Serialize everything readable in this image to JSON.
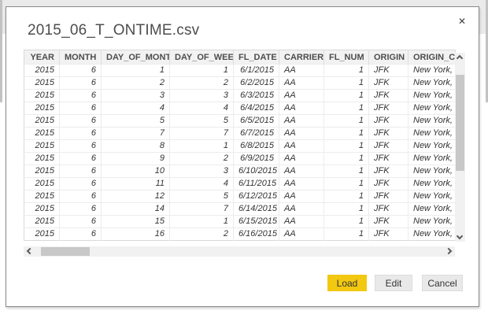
{
  "dialog": {
    "title": "2015_06_T_ONTIME.csv",
    "close_glyph": "✕"
  },
  "table": {
    "columns": [
      {
        "label": "YEAR",
        "align": "right"
      },
      {
        "label": "MONTH",
        "align": "right"
      },
      {
        "label": "DAY_OF_MONTH",
        "align": "right"
      },
      {
        "label": "DAY_OF_WEEK",
        "align": "right"
      },
      {
        "label": "FL_DATE",
        "align": "right"
      },
      {
        "label": "CARRIER",
        "align": "left"
      },
      {
        "label": "FL_NUM",
        "align": "right"
      },
      {
        "label": "ORIGIN",
        "align": "left"
      },
      {
        "label": "ORIGIN_CI",
        "align": "left"
      }
    ],
    "rows": [
      [
        "2015",
        "6",
        "1",
        "1",
        "6/1/2015",
        "AA",
        "1",
        "JFK",
        "New York,"
      ],
      [
        "2015",
        "6",
        "2",
        "2",
        "6/2/2015",
        "AA",
        "1",
        "JFK",
        "New York,"
      ],
      [
        "2015",
        "6",
        "3",
        "3",
        "6/3/2015",
        "AA",
        "1",
        "JFK",
        "New York,"
      ],
      [
        "2015",
        "6",
        "4",
        "4",
        "6/4/2015",
        "AA",
        "1",
        "JFK",
        "New York,"
      ],
      [
        "2015",
        "6",
        "5",
        "5",
        "6/5/2015",
        "AA",
        "1",
        "JFK",
        "New York,"
      ],
      [
        "2015",
        "6",
        "7",
        "7",
        "6/7/2015",
        "AA",
        "1",
        "JFK",
        "New York,"
      ],
      [
        "2015",
        "6",
        "8",
        "1",
        "6/8/2015",
        "AA",
        "1",
        "JFK",
        "New York,"
      ],
      [
        "2015",
        "6",
        "9",
        "2",
        "6/9/2015",
        "AA",
        "1",
        "JFK",
        "New York,"
      ],
      [
        "2015",
        "6",
        "10",
        "3",
        "6/10/2015",
        "AA",
        "1",
        "JFK",
        "New York,"
      ],
      [
        "2015",
        "6",
        "11",
        "4",
        "6/11/2015",
        "AA",
        "1",
        "JFK",
        "New York,"
      ],
      [
        "2015",
        "6",
        "12",
        "5",
        "6/12/2015",
        "AA",
        "1",
        "JFK",
        "New York,"
      ],
      [
        "2015",
        "6",
        "14",
        "7",
        "6/14/2015",
        "AA",
        "1",
        "JFK",
        "New York,"
      ],
      [
        "2015",
        "6",
        "15",
        "1",
        "6/15/2015",
        "AA",
        "1",
        "JFK",
        "New York,"
      ],
      [
        "2015",
        "6",
        "16",
        "2",
        "6/16/2015",
        "AA",
        "1",
        "JFK",
        "New York,"
      ]
    ]
  },
  "buttons": {
    "load": "Load",
    "edit": "Edit",
    "cancel": "Cancel"
  },
  "colors": {
    "accent_yellow": "#F2C811",
    "button_gray": "#E9E9E9",
    "header_bg": "#F2F2F2",
    "dialog_border": "#8A8A8A"
  }
}
